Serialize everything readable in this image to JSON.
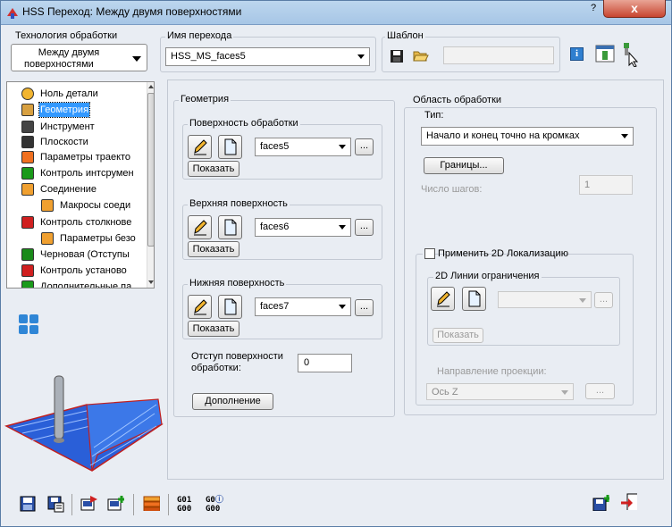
{
  "window": {
    "title": "HSS Переход: Между двумя поверхностями",
    "help": "?",
    "close": "x"
  },
  "tech": {
    "label": "Технология обработки",
    "value_line1": "Между двумя",
    "value_line2": "поверхностями"
  },
  "op_name": {
    "label": "Имя перехода",
    "value": "HSS_MS_faces5"
  },
  "template": {
    "label": "Шаблон",
    "value": ""
  },
  "tree": {
    "items": [
      {
        "label": "Ноль детали",
        "icon": "origin-icon"
      },
      {
        "label": "Геометрия",
        "icon": "geometry-icon",
        "selected": true
      },
      {
        "label": "Инструмент",
        "icon": "tool-icon"
      },
      {
        "label": "Плоскости",
        "icon": "planes-icon"
      },
      {
        "label": "Параметры траекто",
        "icon": "toolpath-params-icon"
      },
      {
        "label": "Контроль интсрумен",
        "icon": "tool-control-icon"
      },
      {
        "label": "Соединение",
        "icon": "link-icon"
      },
      {
        "label": "Макросы соеди",
        "icon": "link-macros-icon"
      },
      {
        "label": "Контроль столкнове",
        "icon": "collision-icon"
      },
      {
        "label": "Параметры безо",
        "icon": "safety-params-icon"
      },
      {
        "label": "Черновая (Отступы",
        "icon": "roughing-icon"
      },
      {
        "label": "Контроль установо",
        "icon": "setup-control-icon"
      },
      {
        "label": "Дополнительные па",
        "icon": "extra-params-icon"
      }
    ]
  },
  "geometry": {
    "title": "Геометрия",
    "surface": {
      "label": "Поверхность обработки",
      "value": "faces5",
      "show": "Показать",
      "more": "..."
    },
    "top": {
      "label": "Верхняя поверхность",
      "value": "faces6",
      "show": "Показать",
      "more": "..."
    },
    "bottom": {
      "label": "Нижняя поверхность",
      "value": "faces7",
      "show": "Показать",
      "more": "..."
    },
    "offset": {
      "label_line1": "Отступ поверхности",
      "label_line2": "обработки:",
      "value": "0"
    },
    "extra_button": "Дополнение"
  },
  "area": {
    "title": "Область обработки",
    "type_label": "Тип:",
    "type_value": "Начало и конец точно на кромках",
    "bounds_button": "Границы...",
    "steps_label": "Число шагов:",
    "steps_value": "1",
    "localization_checkbox": "Применить 2D Локализацию",
    "limit_lines_label": "2D Линии ограничения",
    "limit_value": "",
    "show": "Показать",
    "more": "...",
    "projection_label": "Направление проекции:",
    "projection_value": "Ось Z"
  },
  "bottom_toolbar": {
    "g1_top": "G01",
    "g1_bottom": "G00",
    "g2_top": "G0",
    "g2_bottom": "G00"
  }
}
